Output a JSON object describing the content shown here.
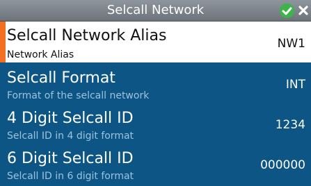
{
  "header": {
    "title": "Selcall Network",
    "ok_icon": "check-icon",
    "close_icon": "close-icon",
    "ok_color": "#3cb44a"
  },
  "settings": [
    {
      "label": "Selcall Network Alias",
      "description": "Network Alias",
      "value": "NW1",
      "selected": true
    },
    {
      "label": "Selcall Format",
      "description": "Format of the selcall network",
      "value": "INT",
      "selected": false
    },
    {
      "label": "4 Digit Selcall ID",
      "description": "Selcall ID in 4 digit format",
      "value": "1234",
      "selected": false
    },
    {
      "label": "6 Digit Selcall ID",
      "description": "Selcall ID in 6 digit format",
      "value": "000000",
      "selected": false
    }
  ],
  "colors": {
    "background": "#0d5584",
    "selected_background": "#ffffff",
    "selection_accent": "#f36f21",
    "description_text": "#9cc4df"
  }
}
